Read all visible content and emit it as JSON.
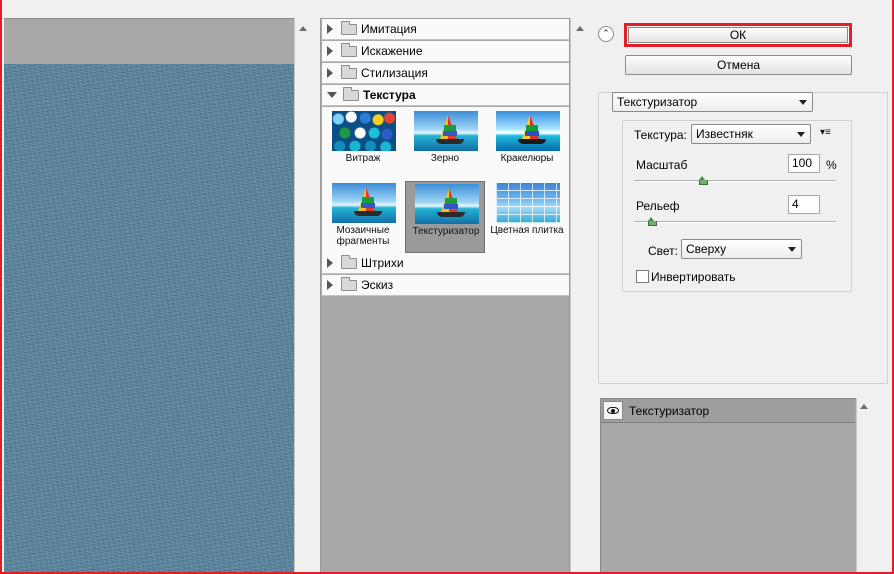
{
  "categories": {
    "imitation": "Имитация",
    "distortion": "Искажение",
    "stylize": "Стилизация",
    "texture": "Текстура",
    "strokes": "Штрихи",
    "sketch": "Эскиз"
  },
  "texture_filters": [
    {
      "label": "Витраж"
    },
    {
      "label": "Зерно"
    },
    {
      "label": "Кракелюры"
    },
    {
      "label": "Мозаичные фрагменты"
    },
    {
      "label": "Текстуризатор",
      "selected": true
    },
    {
      "label": "Цветная плитка"
    }
  ],
  "buttons": {
    "ok": "ОК",
    "cancel": "Отмена"
  },
  "filter_select": {
    "value": "Текстуризатор"
  },
  "texture_group": {
    "texture_label": "Текстура:",
    "texture_value": "Известняк",
    "scale_label": "Масштаб",
    "scale_value": "100",
    "scale_unit": "%",
    "scale_percent": 100,
    "relief_label": "Рельеф",
    "relief_value": "4",
    "light_label": "Свет:",
    "light_value": "Сверху",
    "invert_label": "Инвертировать",
    "invert_checked": false
  },
  "layers": {
    "items": [
      {
        "name": "Текстуризатор",
        "visible": true
      }
    ]
  },
  "colors": {
    "ok_highlight": "#e41e26",
    "preview_texture": "#55809a"
  }
}
